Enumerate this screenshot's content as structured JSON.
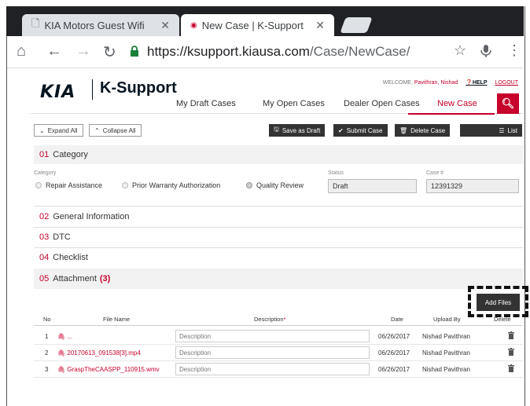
{
  "browser": {
    "tabs": [
      {
        "title": "KIA Motors Guest Wifi",
        "close": "✕"
      },
      {
        "title": "New Case | K-Support",
        "close": "✕"
      }
    ],
    "url_domain": "https://ksupport.kiausa.com",
    "url_path": "/Case/NewCase/"
  },
  "site": {
    "logo_brand": "KIA",
    "logo_product": "K-Support",
    "welcome_label": "WELCOME,",
    "user_name": "Pavithran, Nishad",
    "help": "HELP",
    "logout": "LOGOUT",
    "nav": [
      "My Draft Cases",
      "My Open Cases",
      "Dealer Open Cases",
      "New Case"
    ]
  },
  "actions": {
    "expand_all": "Expand All",
    "collapse_all": "Collapse All",
    "save_draft": "Save as Draft",
    "submit": "Submit Case",
    "delete": "Delete Case",
    "list": "List"
  },
  "sections": [
    {
      "num": "01",
      "title": "Category"
    },
    {
      "num": "02",
      "title": "General Information"
    },
    {
      "num": "03",
      "title": "DTC"
    },
    {
      "num": "04",
      "title": "Checklist"
    },
    {
      "num": "05",
      "title": "Attachment",
      "count": "(3)"
    }
  ],
  "category": {
    "label": "Category",
    "options": [
      "Repair Assistance",
      "Prior Warranty Authorization",
      "Quality Review"
    ],
    "selected": "Quality Review",
    "status_label": "Status",
    "status_value": "Draft",
    "case_label": "Case #",
    "case_value": "12391329"
  },
  "attachment": {
    "add_files": "Add Files",
    "columns": [
      "No",
      "File Name",
      "Description",
      "*",
      "Date",
      "Upload By",
      "Delete"
    ],
    "rows": [
      {
        "no": "1",
        "file": "...",
        "desc_placeholder": "Description",
        "date": "06/26/2017",
        "by": "Nishad Pavithran"
      },
      {
        "no": "2",
        "file": "20170613_091538[3].mp4",
        "desc_placeholder": "Description",
        "date": "06/26/2017",
        "by": "Nishad Pavithran"
      },
      {
        "no": "3",
        "file": "GraspTheCAASPP_110915.wmv",
        "desc_placeholder": "Description",
        "date": "06/26/2017",
        "by": "Nishad Pavithran"
      }
    ]
  },
  "colors": {
    "brand_red": "#c6002b",
    "dark": "#333333"
  }
}
